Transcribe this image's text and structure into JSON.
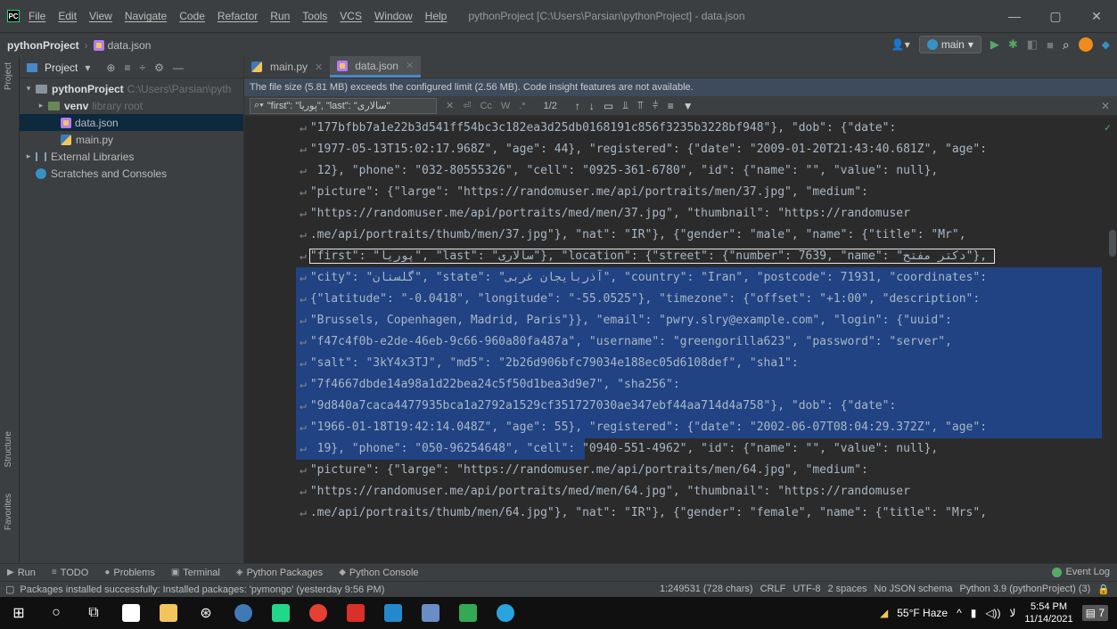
{
  "window": {
    "title": "pythonProject [C:\\Users\\Parsian\\pythonProject] - data.json",
    "menu": [
      "File",
      "Edit",
      "View",
      "Navigate",
      "Code",
      "Refactor",
      "Run",
      "Tools",
      "VCS",
      "Window",
      "Help"
    ],
    "controls": {
      "minimize": "—",
      "maximize": "▢",
      "close": "✕"
    }
  },
  "navbar": {
    "project": "pythonProject",
    "file": "data.json",
    "branch": "main"
  },
  "left_strip": {
    "top_label": "Project",
    "mid_label": "Structure",
    "bottom_label": "Favorites"
  },
  "project_pane": {
    "header": "Project",
    "tree": [
      {
        "name": "pythonProject",
        "hint": "C:\\Users\\Parsian\\pyth",
        "kind": "folder",
        "expanded": true
      },
      {
        "name": "venv",
        "hint": "library root",
        "kind": "venv",
        "expanded": false
      },
      {
        "name": "data.json",
        "hint": "",
        "kind": "json"
      },
      {
        "name": "main.py",
        "hint": "",
        "kind": "py"
      },
      {
        "name": "External Libraries",
        "hint": "",
        "kind": "lib"
      },
      {
        "name": "Scratches and Consoles",
        "hint": "",
        "kind": "scratch"
      }
    ]
  },
  "editor": {
    "tabs": [
      {
        "name": "main.py",
        "active": false
      },
      {
        "name": "data.json",
        "active": true
      }
    ],
    "banner": "The file size (5.81 MB) exceeds the configured limit (2.56 MB). Code insight features are not available.",
    "find": {
      "query": "\"first\": \"پوریا\", \"last\": \"سالاری\"",
      "case_label": "Cc",
      "word_label": "W",
      "regex_label": ".*",
      "count": "1/2"
    },
    "lines": [
      "\"177bfbb7a1e22b3d541ff54bc3c182ea3d25db0168191c856f3235b3228bf948\"}, \"dob\": {\"date\": ",
      "\"1977-05-13T15:02:17.968Z\", \"age\": 44}, \"registered\": {\"date\": \"2009-01-20T21:43:40.681Z\", \"age\":",
      " 12}, \"phone\": \"032-80555326\", \"cell\": \"0925-361-6780\", \"id\": {\"name\": \"\", \"value\": null}, ",
      "\"picture\": {\"large\": \"https://randomuser.me/api/portraits/men/37.jpg\", \"medium\": ",
      "\"https://randomuser.me/api/portraits/med/men/37.jpg\", \"thumbnail\": \"https://randomuser",
      ".me/api/portraits/thumb/men/37.jpg\"}, \"nat\": \"IR\"}, {\"gender\": \"male\", \"name\": {\"title\": \"Mr\", ",
      "\"first\": \"پوریا\", \"last\": \"سالاری\"}, \"location\": {\"street\": {\"number\": 7639, \"name\": \"دکتر مفتح\"}, ",
      "\"city\": \"گلستان\", \"state\": \"آذربایجان غربی\", \"country\": \"Iran\", \"postcode\": 71931, \"coordinates\": ",
      "{\"latitude\": \"-0.0418\", \"longitude\": \"-55.0525\"}, \"timezone\": {\"offset\": \"+1:00\", \"description\": ",
      "\"Brussels, Copenhagen, Madrid, Paris\"}}, \"email\": \"pwry.slry@example.com\", \"login\": {\"uuid\": ",
      "\"f47c4f0b-e2de-46eb-9c66-960a80fa487a\", \"username\": \"greengorilla623\", \"password\": \"server\", ",
      "\"salt\": \"3kY4x3TJ\", \"md5\": \"2b26d906bfc79034e188ec05d6108def\", \"sha1\": ",
      "\"7f4667dbde14a98a1d22bea24c5f50d1bea3d9e7\", \"sha256\": ",
      "\"9d840a7caca4477935bca1a2792a1529cf351727030ae347ebf44aa714d4a758\"}, \"dob\": {\"date\": ",
      "\"1966-01-18T19:42:14.048Z\", \"age\": 55}, \"registered\": {\"date\": \"2002-06-07T08:04:29.372Z\", \"age\":",
      " 19}, \"phone\": \"050-96254648\", \"cell\": \"0940-551-4962\", \"id\": {\"name\": \"\", \"value\": null}, ",
      "\"picture\": {\"large\": \"https://randomuser.me/api/portraits/men/64.jpg\", \"medium\": ",
      "\"https://randomuser.me/api/portraits/med/men/64.jpg\", \"thumbnail\": \"https://randomuser",
      ".me/api/portraits/thumb/men/64.jpg\"}, \"nat\": \"IR\"}, {\"gender\": \"female\", \"name\": {\"title\": \"Mrs\", "
    ]
  },
  "tool_windows": [
    "Run",
    "TODO",
    "Problems",
    "Terminal",
    "Python Packages",
    "Python Console"
  ],
  "event_log": "Event Log",
  "status": {
    "message": "Packages installed successfully: Installed packages: 'pymongo' (yesterday 9:56 PM)",
    "position": "1:249531 (728 chars)",
    "line_sep": "CRLF",
    "encoding": "UTF-8",
    "indent": "2 spaces",
    "schema": "No JSON schema",
    "interpreter": "Python 3.9 (pythonProject) (3)"
  },
  "taskbar": {
    "weather": "55°F Haze",
    "time": "5:54 PM",
    "date": "11/14/2021",
    "lang": "ﻻ",
    "notif_count": "7"
  },
  "colors": {
    "selection": "#214283",
    "accent": "#4a88c7",
    "panel": "#3c3f41",
    "editor_bg": "#2b2b2b"
  }
}
